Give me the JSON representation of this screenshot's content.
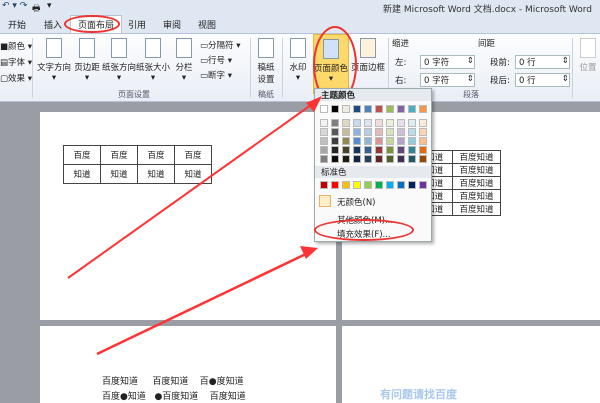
{
  "window": {
    "title": "新建 Microsoft Word 文档.docx - Microsoft Word"
  },
  "tabs": [
    "开始",
    "插入",
    "页面布局",
    "引用",
    "审阅",
    "视图"
  ],
  "ribbon": {
    "theme_items": [
      "颜色",
      "字体",
      "效果"
    ],
    "page_setup": [
      "文字方向",
      "页边距",
      "纸张方向",
      "纸张大小",
      "分栏"
    ],
    "page_setup_small": [
      "分隔符",
      "行号",
      "断字"
    ],
    "page_setup_label": "页面设置",
    "draft": "稿纸\n设置",
    "draft_label": "稿纸",
    "watermark": "水印",
    "page_color": "页面颜色",
    "page_border": "页面边框",
    "indent_label": "缩进",
    "indent_left_label": "左:",
    "indent_left": "0 字符",
    "indent_right_label": "右:",
    "indent_right": "0 字符",
    "spacing_label": "间距",
    "before_label": "段前:",
    "before": "0 行",
    "after_label": "段后:",
    "after": "0 行",
    "paragraph_label": "段落",
    "position": "位置"
  },
  "menu": {
    "theme_colors_label": "主题颜色",
    "theme_top": [
      "#ffffff",
      "#000000",
      "#eeece1",
      "#1f497d",
      "#4f81bd",
      "#c0504d",
      "#9bbb59",
      "#8064a2",
      "#4bacc6",
      "#f79646"
    ],
    "theme_shades": [
      [
        "#f2f2f2",
        "#d8d8d8",
        "#bfbfbf",
        "#a5a5a5",
        "#7f7f7f"
      ],
      [
        "#7f7f7f",
        "#595959",
        "#3f3f3f",
        "#262626",
        "#0c0c0c"
      ],
      [
        "#ddd9c3",
        "#c4bd97",
        "#938953",
        "#494429",
        "#1d1b10"
      ],
      [
        "#c6d9f0",
        "#8db3e2",
        "#548dd4",
        "#17365d",
        "#0f243e"
      ],
      [
        "#dbe5f1",
        "#b8cce4",
        "#95b3d7",
        "#366092",
        "#244061"
      ],
      [
        "#f2dcdb",
        "#e5b9b7",
        "#d99694",
        "#953734",
        "#632423"
      ],
      [
        "#ebf1dd",
        "#d7e3bc",
        "#c3d69b",
        "#76923c",
        "#4f6128"
      ],
      [
        "#e5e0ec",
        "#ccc1d9",
        "#b2a2c7",
        "#5f497a",
        "#3f3151"
      ],
      [
        "#dbeef3",
        "#b7dde8",
        "#92cddc",
        "#31859b",
        "#205867"
      ],
      [
        "#fdeada",
        "#fbd5b5",
        "#fac08f",
        "#e36c09",
        "#974806"
      ]
    ],
    "standard_label": "标准色",
    "standard": [
      "#c00000",
      "#ff0000",
      "#ffc000",
      "#ffff00",
      "#92d050",
      "#00b050",
      "#00b0f0",
      "#0070c0",
      "#002060",
      "#7030a0"
    ],
    "no_color": "无颜色(N)",
    "more_colors": "其他颜色(M)...",
    "fill_effects": "填充效果(F)..."
  },
  "doc": {
    "table1": [
      [
        "百度",
        "百度",
        "百度",
        "百度"
      ],
      [
        "知道",
        "知道",
        "知道",
        "知道"
      ]
    ],
    "table2": [
      "度知道",
      "百度知道"
    ],
    "lines": [
      [
        "百度知道",
        "百度知道",
        "百●度知道"
      ],
      [
        "百度●知道",
        "●百度知道",
        "百度知道"
      ]
    ],
    "watermark": "有问题请找百度"
  },
  "accent": "#ff3333"
}
